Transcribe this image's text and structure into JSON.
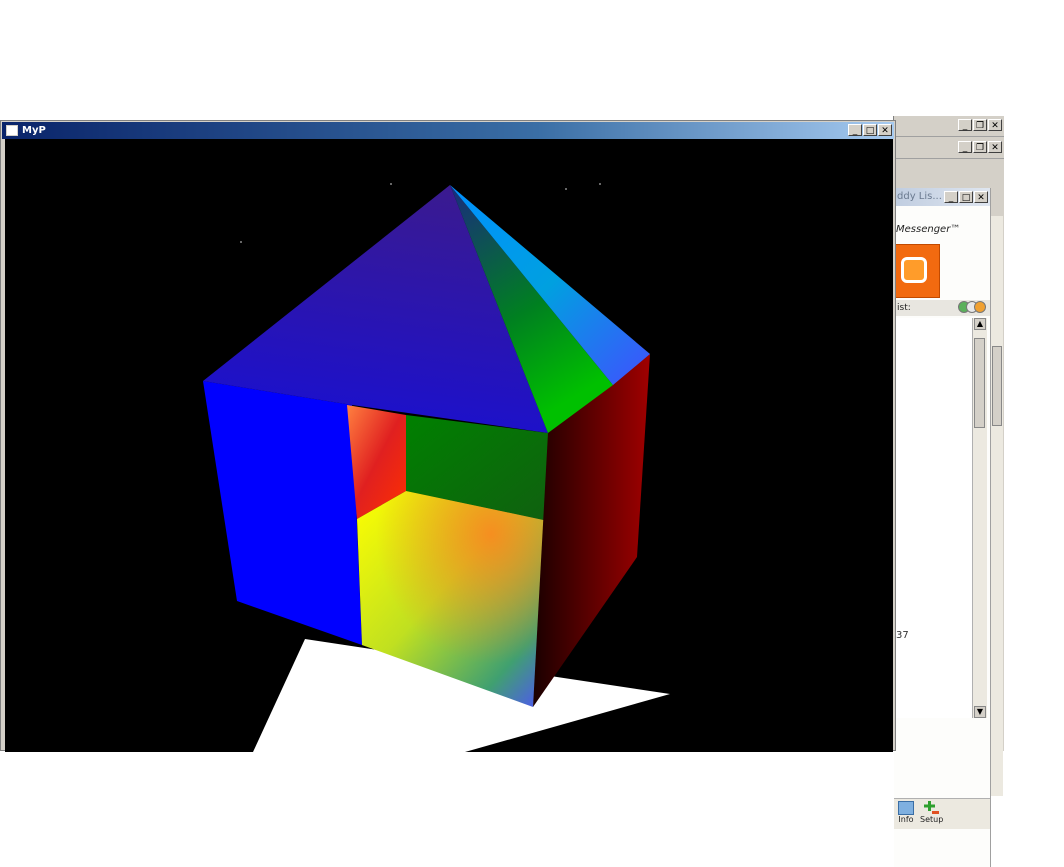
{
  "main_window": {
    "title": "MyP",
    "buttons": {
      "minimize": "_",
      "maximize": "□",
      "close": "✕"
    }
  },
  "background_windows": {
    "buttons": {
      "minimize": "_",
      "restore": "❐",
      "close": "✕"
    }
  },
  "messenger": {
    "title": "ddy Lis...",
    "brand": "Messenger™",
    "list_label": "ist:",
    "list_number": "37",
    "bottom": {
      "info_label": "Info",
      "setup_label": "Setup"
    }
  },
  "colors": {
    "title_bar_start": "#0a246a",
    "title_bar_end": "#a6caf0",
    "window_face": "#d4d0c8",
    "viewport_background": "#000000",
    "banner_orange": "#f26a10"
  },
  "icons": {
    "app": "window-icon",
    "minimize": "minimize-icon",
    "maximize": "maximize-icon",
    "close": "close-icon",
    "info": "info-icon",
    "setup": "add-contact-icon"
  }
}
